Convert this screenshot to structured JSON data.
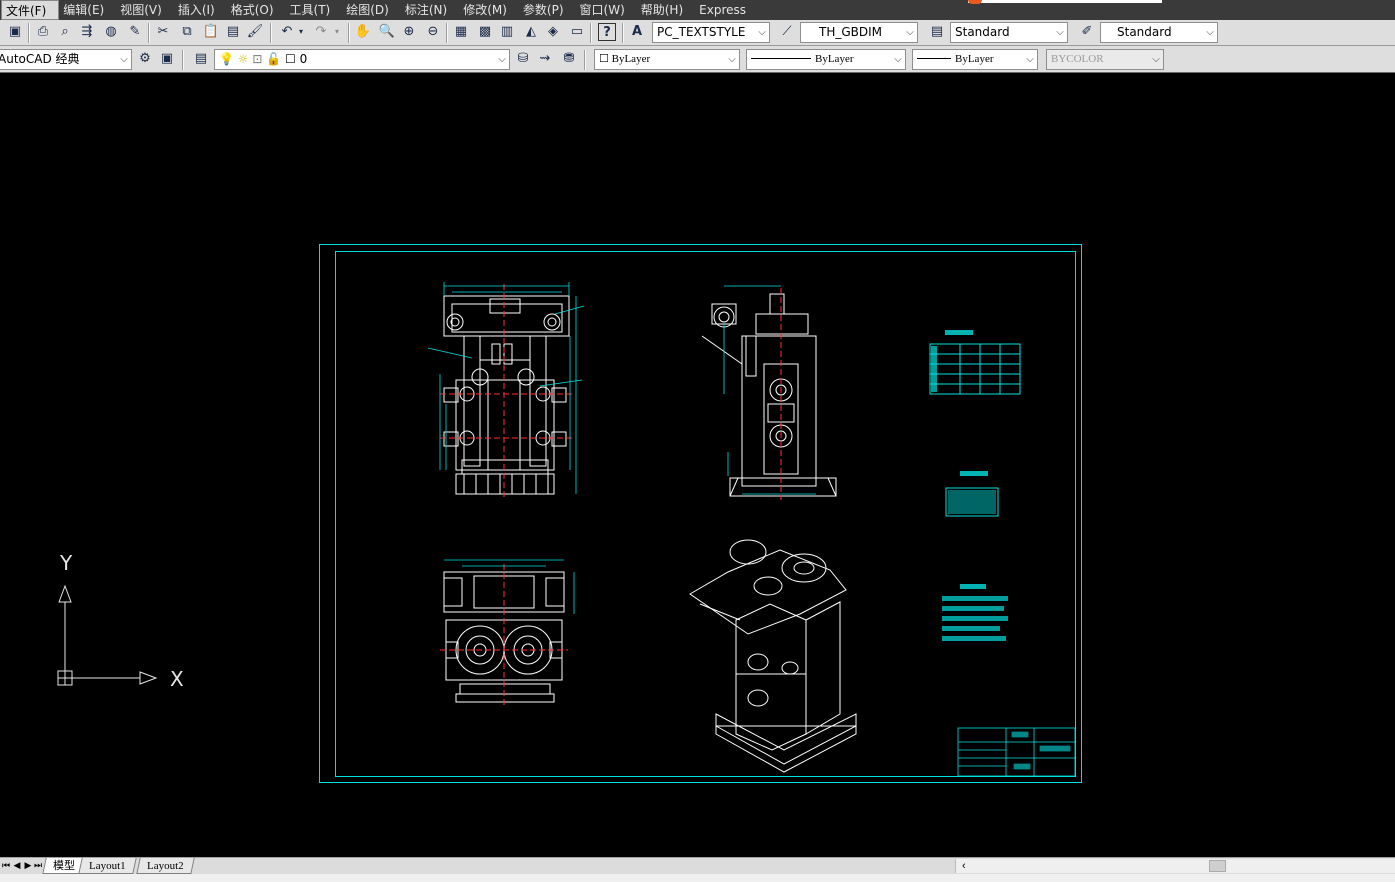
{
  "menu": [
    "文件(F)",
    "编辑(E)",
    "视图(V)",
    "插入(I)",
    "格式(O)",
    "工具(T)",
    "绘图(D)",
    "标注(N)",
    "修改(M)",
    "参数(P)",
    "窗口(W)",
    "帮助(H)",
    "Express"
  ],
  "toolbar1": {
    "text_style": "PC_TEXTSTYLE",
    "dim_style": "TH_GBDIM",
    "table_style": "Standard",
    "multileader_style": "Standard"
  },
  "toolbar2": {
    "workspace": "AutoCAD 经典",
    "layer": "0",
    "color": "ByLayer",
    "linetype": "ByLayer",
    "lineweight": "ByLayer",
    "plotstyle": "BYCOLOR"
  },
  "ucs": {
    "y_label": "Y",
    "x_label": "X"
  },
  "tabs": [
    "模型",
    "Layout1",
    "Layout2"
  ],
  "colors": {
    "frame": "#00e0e0",
    "cyan_text": "#00ffff",
    "geometry": "#ffffff",
    "centerline": "#ff3030"
  }
}
